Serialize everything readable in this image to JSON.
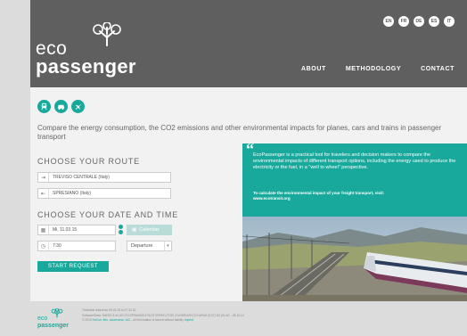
{
  "header": {
    "logo_line1": "eco",
    "logo_line2": "passenger",
    "languages": [
      "EN",
      "FR",
      "DE",
      "ES",
      "IT"
    ],
    "nav": [
      "ABOUT",
      "METHODOLOGY",
      "CONTACT"
    ]
  },
  "modes": [
    "train-icon",
    "car-icon",
    "plane-icon"
  ],
  "intro": "Compare the energy consumption, the CO2 emissions and other environmental impacts for planes, cars and trains in passenger transport",
  "route": {
    "heading": "CHOOSE YOUR ROUTE",
    "from": "TREVISO CENTRALE (Italy)",
    "to": "SPRESIANO (Italy)"
  },
  "datetime": {
    "heading": "CHOOSE YOUR DATE AND TIME",
    "date": "Mi, 11.03.15",
    "calendar_label": "Calendar",
    "time": "7:30",
    "departure": "Departure"
  },
  "start_button": "START REQUEST",
  "promo": {
    "text": "EcoPassenger is a practical tool for travelers and decision makers to compare the environmental impacts of different transport options, including the energy used to produce the electricity or the fuel, in a \"well to wheel\" perspective.",
    "freight_line1": "To calculate the environmental impact of your freight transport, visit:",
    "freight_line2": "www.ecotransit.org"
  },
  "footer": {
    "logo_line1": "eco",
    "logo_line2": "passenger",
    "line1": "Timetable data from 09.03.15 to 07.12.15",
    "line2": "Software/Data: HAFAS 5.44.UIC.ECOTRANS/5.37/5.37 SPEED (TGE) 2G/HERUCECO.HAFAS (5.37) 3G (H) 4G - 28.10.14",
    "line3_prefix": "© 2015",
    "line3_link": "HaCon, ifeu, awareness, UIC",
    "line3_suffix": "- All information is issued without liability",
    "line3_imprint": "Imprint"
  },
  "colors": {
    "accent": "#19a99c",
    "header_bg": "#5f5f5f",
    "page_bg": "#f2f2f2"
  }
}
